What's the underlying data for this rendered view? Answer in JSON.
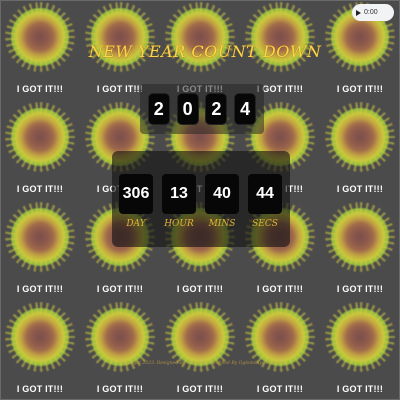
{
  "page": {
    "bg_color": "#4b4b4b"
  },
  "audio": {
    "time": "0:00",
    "play_icon": "play-icon"
  },
  "background": {
    "tile_label": "I GOT IT!!!",
    "burst_icon": "firework-burst"
  },
  "header": {
    "title": "NEW YEAR COUNT DOWN",
    "color": "#ffd34a"
  },
  "year": {
    "digits": [
      "2",
      "0",
      "2",
      "4"
    ]
  },
  "countdown": {
    "units": [
      {
        "value": "306",
        "label": "DAY"
      },
      {
        "value": "13",
        "label": "HOUR"
      },
      {
        "value": "40",
        "label": "MINS"
      },
      {
        "value": "44",
        "label": "SECS"
      }
    ],
    "label_color": "#e3b13a"
  },
  "footer": {
    "credit": "Copyright 2023. Designed By Codehal . Modified By Ogbonnaya Ekuma"
  }
}
